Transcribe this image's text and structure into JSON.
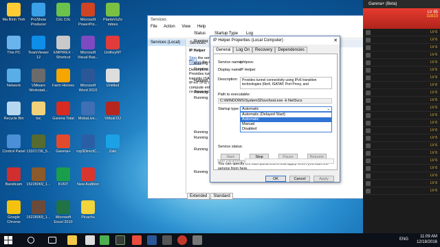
{
  "desktop": {
    "icons": [
      {
        "label": "Ma Bình Tình",
        "color": "#ffcc33"
      },
      {
        "label": "ProShow Producer",
        "color": "#3aa0e8"
      },
      {
        "label": "Cốc Cốc",
        "color": "#6cc24a"
      },
      {
        "label": "Microsoft PowerPoi...",
        "color": "#d04423"
      },
      {
        "label": "PlantsVsZo mbies",
        "color": "#7ac143"
      },
      {
        "label": "This PC",
        "color": "#6ab4ee"
      },
      {
        "label": "TeamViewer 12",
        "color": "#0e8ee9"
      },
      {
        "label": "EMPIREX - Shortcut",
        "color": "#c9c9c9"
      },
      {
        "label": "Microsoft Visual Bas...",
        "color": "#7d4ac1"
      },
      {
        "label": "UniKeyNT",
        "color": "#e23b3b"
      },
      {
        "label": "Network",
        "color": "#5aaee8"
      },
      {
        "label": "VMware Workstati...",
        "color": "#6b6b6b"
      },
      {
        "label": "Farm Heroes",
        "color": "#f7a500"
      },
      {
        "label": "Microsoft Word 2010",
        "color": "#2b5797"
      },
      {
        "label": "Untitled",
        "color": "#dddddd"
      },
      {
        "label": "Recycle Bin",
        "color": "#b7d7f0"
      },
      {
        "label": "toc",
        "color": "#f1d27a"
      },
      {
        "label": "Garena Total",
        "color": "#d92b20"
      },
      {
        "label": "MobaLive...",
        "color": "#3f6fb5"
      },
      {
        "label": "Virtual DJ",
        "color": "#b5261e"
      },
      {
        "label": "Control Panel",
        "color": "#4b8fd6"
      },
      {
        "label": "13321736_5...",
        "color": "#556b2f"
      },
      {
        "label": "Garena+",
        "color": "#e24a2e"
      },
      {
        "label": "mp3DirectC...",
        "color": "#2a5fa6"
      },
      {
        "label": "Zalo",
        "color": "#1ba1e6"
      },
      {
        "label": "Bandicam",
        "color": "#cf2f2f"
      },
      {
        "label": "15228069_1...",
        "color": "#8b5a2b"
      },
      {
        "label": "KVRT",
        "color": "#1a9e4b"
      },
      {
        "label": "New Audition",
        "color": "#d9352f"
      },
      {
        "label": "",
        "color": "#00000000"
      },
      {
        "label": "Google Chrome",
        "color": "#f4c20d"
      },
      {
        "label": "15228069_1...",
        "color": "#6a4b3b"
      },
      {
        "label": "Microsoft Excel 2010",
        "color": "#217346"
      },
      {
        "label": "Picachu",
        "color": "#f2d43b"
      }
    ]
  },
  "services": {
    "title": "Services",
    "menu": [
      "File",
      "Action",
      "View",
      "Help"
    ],
    "tree_node": "Services (Local)",
    "header": "Services",
    "selected_name": "IP Helper",
    "stop_link": "Stop",
    "stop_rest": " the serv",
    "restart_link": "Restart",
    "restart_rest": " the se",
    "desc_label": "Description:",
    "desc_text": "Provides tunn IPv6 transitio ISATAP, Port IP-HTTPS, If the compute enhanced co these techno",
    "columns": {
      "status": "Status",
      "startup": "Startup Type",
      "log": "Log"
    },
    "rows": [
      {
        "status": "Running",
        "startup": "Automatic",
        "log": "Lo"
      },
      {
        "status": "",
        "startup": "Manual",
        "log": "Lo"
      },
      {
        "status": "",
        "startup": "Manual",
        "log": "Lo"
      },
      {
        "status": "",
        "startup": "Disabled",
        "log": "Lo"
      },
      {
        "status": "Running",
        "startup": "Automatic",
        "log": "Lo"
      },
      {
        "status": "Running",
        "startup": "Manual (Trig...",
        "log": "Lo"
      },
      {
        "status": "",
        "startup": "Manual",
        "log": "Lo"
      },
      {
        "status": "Running",
        "startup": "Manual (Trig...",
        "log": "Lo"
      },
      {
        "status": "",
        "startup": "Manual (Trig...",
        "log": "Lo"
      },
      {
        "status": "Running",
        "startup": "Automatic",
        "log": "Lo"
      },
      {
        "status": "Running",
        "startup": "Manual",
        "log": "Lo"
      },
      {
        "status": "",
        "startup": "Manual",
        "log": "Ne"
      },
      {
        "status": "",
        "startup": "Manual (Trig...",
        "log": "Lo"
      },
      {
        "status": "",
        "startup": "Manual",
        "log": "Lo"
      },
      {
        "status": "",
        "startup": "Disabled",
        "log": "Lo"
      },
      {
        "status": "",
        "startup": "Manual",
        "log": "Lo"
      },
      {
        "status": "Running",
        "startup": "Manual (Trig...",
        "log": "Lo"
      },
      {
        "status": "Running",
        "startup": "Manual (Trig...",
        "log": "Lo"
      },
      {
        "status": "",
        "startup": "Manual",
        "log": "Lo"
      },
      {
        "status": "Running",
        "startup": "Automatic",
        "log": "Lo"
      },
      {
        "status": "",
        "startup": "Manual",
        "log": "Ne"
      },
      {
        "status": "",
        "startup": "Manual",
        "log": "Lo"
      },
      {
        "status": "",
        "startup": "Manual",
        "log": "Lo"
      },
      {
        "status": "Running",
        "startup": "Manual",
        "log": "Lo"
      }
    ],
    "tabs": [
      "Extended",
      "Standard"
    ]
  },
  "dialog": {
    "title": "IP Helper Properties (Local Computer)",
    "close": "✕",
    "tabs": [
      "General",
      "Log On",
      "Recovery",
      "Dependencies"
    ],
    "service_name_label": "Service name:",
    "service_name": "iphlpsvc",
    "display_name_label": "Display name:",
    "display_name": "IP Helper",
    "description_label": "Description:",
    "description": "Provides tunnel connectivity using IPv6 transition technologies (6to4, ISATAP, Port Proxy, and",
    "path_label": "Path to executable:",
    "path": "C:\\WINDOWS\\System32\\svchost.exe -k NetSvcs",
    "startup_label": "Startup type:",
    "startup_value": "Automatic",
    "startup_options": [
      "Automatic (Delayed Start)",
      "Automatic",
      "Manual",
      "Disabled"
    ],
    "status_label": "Service status:",
    "buttons": {
      "start": "Start",
      "stop": "Stop",
      "pause": "Pause",
      "resume": "Resume"
    },
    "note": "You can specify the start parameters that apply when you start the service from here.",
    "start_params_label": "Start parameters:",
    "ok": "OK",
    "cancel": "Cancel",
    "apply": "Apply"
  },
  "garena": {
    "title": "Garena+ (Beta)",
    "level": "LV 85",
    "points": "32823",
    "rows": [
      "LV 6",
      "LV 6",
      "LV 6",
      "LV 6",
      "LV 6",
      "LV 5",
      "LV 6",
      "LV 6",
      "LV 6",
      "LV 6",
      "LV 6",
      "LV 6",
      "LV 6",
      "LV 6",
      "LV 6",
      "LV 6",
      "LV 6",
      "LV 6",
      "LV 6",
      "LV 6",
      "LV 6",
      "LV 6"
    ]
  },
  "taskbar": {
    "lang": "ENG",
    "time": "11:09 AM",
    "date": "12/18/2016"
  }
}
